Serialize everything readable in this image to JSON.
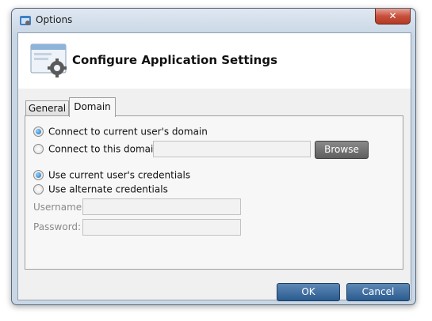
{
  "window": {
    "title": "Options"
  },
  "header": {
    "title": "Configure Application Settings"
  },
  "tabs": [
    {
      "label": "General",
      "selected": false
    },
    {
      "label": "Domain",
      "selected": true
    }
  ],
  "domain_group": {
    "current_domain_label": "Connect to current user's domain",
    "current_domain_checked": true,
    "this_domain_label": "Connect to this domain:",
    "this_domain_checked": false,
    "domain_value": "",
    "browse_label": "Browse"
  },
  "credentials_group": {
    "current_credentials_label": "Use current user's credentials",
    "current_credentials_checked": true,
    "alternate_credentials_label": "Use alternate credentials",
    "alternate_credentials_checked": false,
    "username_label": "Username:",
    "username_value": "",
    "password_label": "Password:",
    "password_value": ""
  },
  "buttons": {
    "ok_label": "OK",
    "cancel_label": "Cancel"
  },
  "colors": {
    "accent_button": "#2b5b8f",
    "radio_checked": "#1f6fb8",
    "close_button": "#c7503b"
  }
}
